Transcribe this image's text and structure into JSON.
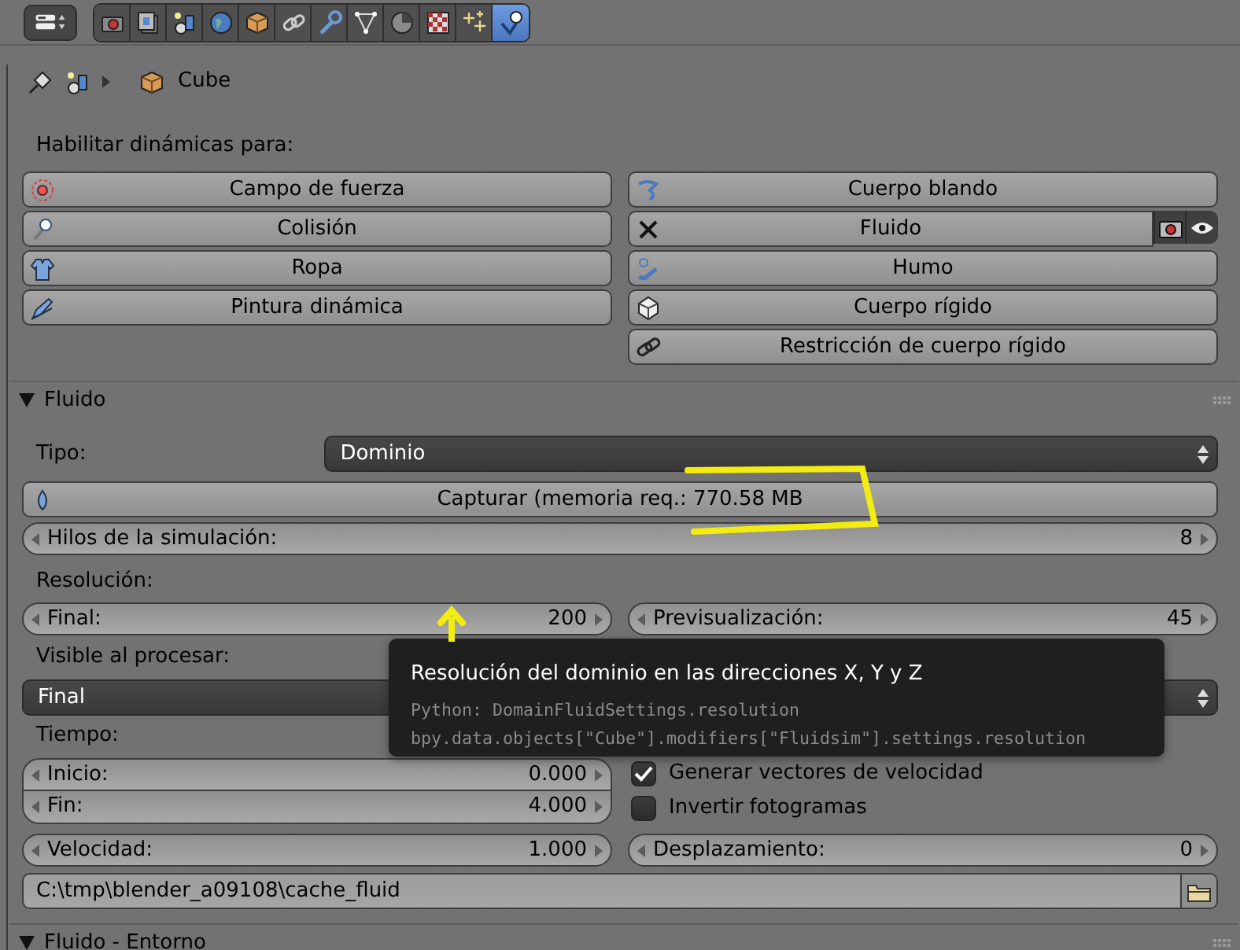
{
  "toolbar": {
    "tabs": [
      {
        "kind": "camera",
        "selected": false
      },
      {
        "kind": "layers",
        "selected": false
      },
      {
        "kind": "scene",
        "selected": false
      },
      {
        "kind": "world",
        "selected": false
      },
      {
        "kind": "object",
        "selected": false
      },
      {
        "kind": "constraints",
        "selected": false
      },
      {
        "kind": "modifiers",
        "selected": false
      },
      {
        "kind": "data",
        "selected": false
      },
      {
        "kind": "material",
        "selected": false
      },
      {
        "kind": "texture",
        "selected": false
      },
      {
        "kind": "particles",
        "selected": false
      },
      {
        "kind": "physics",
        "selected": true
      }
    ]
  },
  "breadcrumb": {
    "object": "Cube"
  },
  "dynamics": {
    "heading": "Habilitar dinámicas para:",
    "left_buttons": [
      {
        "label": "Campo de fuerza",
        "kind": "force",
        "active": false
      },
      {
        "label": "Colisión",
        "kind": "collision",
        "active": false
      },
      {
        "label": "Ropa",
        "kind": "cloth",
        "active": false
      },
      {
        "label": "Pintura dinámica",
        "kind": "paint",
        "active": false
      }
    ],
    "right_buttons": [
      {
        "label": "Cuerpo blando",
        "kind": "softbody",
        "active": false
      },
      {
        "label": "Fluido",
        "kind": "fluid",
        "active": true
      },
      {
        "label": "Humo",
        "kind": "smoke",
        "active": false
      },
      {
        "label": "Cuerpo rígido",
        "kind": "rigid",
        "active": false
      },
      {
        "label": "Restricción de cuerpo rígido",
        "kind": "constraint",
        "active": false
      }
    ]
  },
  "fluid_panel": {
    "title": "Fluido",
    "expanded": true,
    "type": {
      "label": "Tipo:",
      "value": "Dominio"
    },
    "bake_button": "Capturar (memoria req.: 770.58 MB",
    "threads": {
      "label": "Hilos de la simulación:",
      "value": "8"
    },
    "resolution_label": "Resolución:",
    "resolution_fields": [
      {
        "label": "Final:",
        "value": "200"
      },
      {
        "label": "Previsualización:",
        "value": "45"
      }
    ],
    "render_visibility": {
      "label": "Visible al procesar:",
      "value": "Final"
    },
    "time_label": "Tiempo:",
    "time_fields": [
      {
        "label": "Inicio:",
        "value": "0.000"
      },
      {
        "label": "Fin:",
        "value": "4.000"
      }
    ],
    "options": [
      {
        "label": "Generar vectores de velocidad",
        "checked": true
      },
      {
        "label": "Invertir fotogramas",
        "checked": false
      }
    ],
    "speed": {
      "label": "Velocidad:",
      "value": "1.000"
    },
    "offset": {
      "label": "Desplazamiento:",
      "value": "0"
    },
    "cache_path": "C:\\tmp\\blender_a09108\\cache_fluid"
  },
  "next_panel": {
    "title": "Fluido - Entorno",
    "expanded": true
  },
  "tooltip": {
    "title": "Resolución del dominio en las direcciones X, Y y Z",
    "lines": [
      "Python: DomainFluidSettings.resolution",
      "bpy.data.objects[\"Cube\"].modifiers[\"Fluidsim\"].settings.resolution"
    ]
  }
}
